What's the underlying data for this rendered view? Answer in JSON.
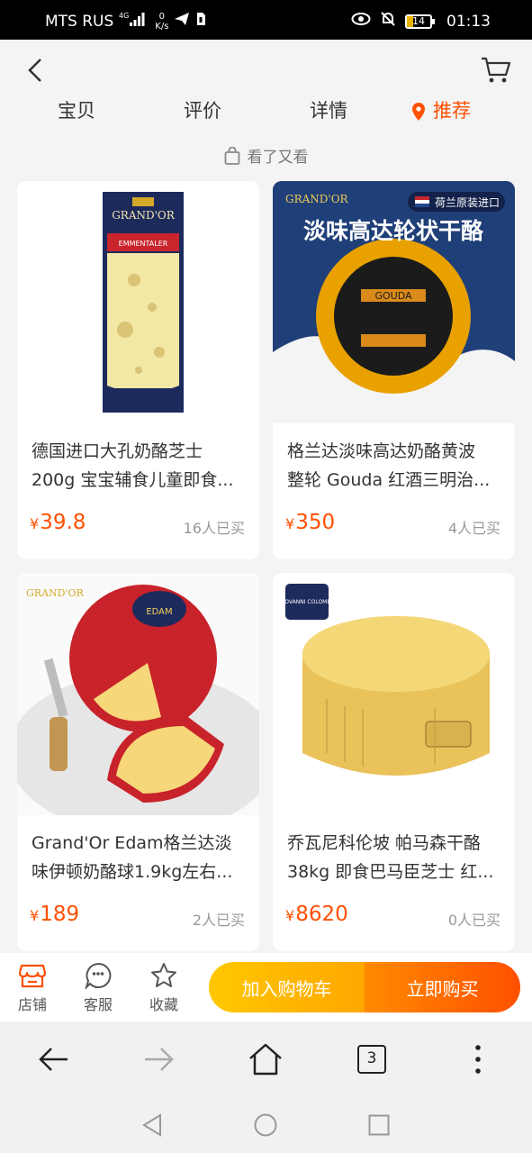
{
  "status_bar": {
    "carrier": "MTS RUS",
    "network": "4G",
    "speed_value": "0",
    "speed_unit": "K/s",
    "battery": "14",
    "time": "01:13"
  },
  "tabs": [
    {
      "label": "宝贝"
    },
    {
      "label": "评价"
    },
    {
      "label": "详情"
    },
    {
      "label": "推荐"
    }
  ],
  "section_label": "看了又看",
  "products": [
    {
      "title_line1": "德国进口大孔奶酪芝士",
      "title_line2": "200g 宝宝辅食儿童即食...",
      "currency": "¥",
      "price": "39.8",
      "sold": "16人已买",
      "image_text_brand": "GRAND'OR",
      "image_text_label": "EMMENTALER"
    },
    {
      "title_line1": "格兰达淡味高达奶酪黄波",
      "title_line2": "整轮 Gouda 红酒三明治...",
      "currency": "¥",
      "price": "350",
      "sold": "4人已买",
      "image_text_brand": "GRAND'OR",
      "image_text_tag": "荷兰原装进口",
      "image_text_headline": "淡味高达轮状干酪",
      "image_text_label": "GOUDA"
    },
    {
      "title_line1": "Grand'Or Edam格兰达淡",
      "title_line2": "味伊顿奶酪球1.9kg左右...",
      "currency": "¥",
      "price": "189",
      "sold": "2人已买",
      "image_text_brand": "GRAND'OR",
      "image_text_label": "EDAM"
    },
    {
      "title_line1": "乔瓦尼科伦坡 帕马森干酪",
      "title_line2": "38kg 即食巴马臣芝士 红...",
      "currency": "¥",
      "price": "8620",
      "sold": "0人已买",
      "image_text_brand": "GIOVANNI COLOMBO"
    }
  ],
  "action_bar": {
    "shop_label": "店铺",
    "service_label": "客服",
    "favorite_label": "收藏",
    "add_to_cart_label": "加入购物车",
    "buy_now_label": "立即购买"
  },
  "browser_bar": {
    "tab_count": "3"
  },
  "colors": {
    "accent": "#ff5000",
    "cart_button": "#ffb300",
    "buy_button": "#ff5a00",
    "background": "#f4f4f4"
  },
  "icons": {
    "back": "chevron-left-icon",
    "cart": "shopping-cart-icon",
    "pin": "location-pin-icon",
    "bag": "shopping-bag-icon",
    "shop": "store-icon",
    "service": "chat-face-icon",
    "favorite": "star-icon"
  }
}
